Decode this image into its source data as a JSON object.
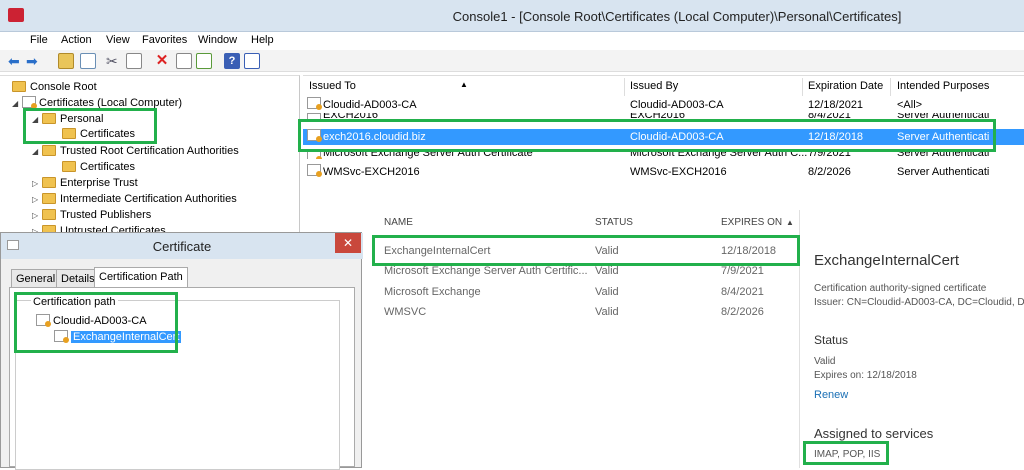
{
  "window": {
    "title": "Console1 - [Console Root\\Certificates (Local Computer)\\Personal\\Certificates]"
  },
  "menu": [
    "File",
    "Action",
    "View",
    "Favorites",
    "Window",
    "Help"
  ],
  "tree": {
    "items": [
      "Console Root",
      "Certificates (Local Computer)",
      "Personal",
      "Certificates",
      "Trusted Root Certification Authorities",
      "Certificates",
      "Enterprise Trust",
      "Intermediate Certification Authorities",
      "Trusted Publishers",
      "Untrusted Certificates"
    ]
  },
  "grid": {
    "columns": [
      "Issued To",
      "Issued By",
      "Expiration Date",
      "Intended Purposes"
    ],
    "rows": [
      [
        "Cloudid-AD003-CA",
        "Cloudid-AD003-CA",
        "12/18/2021",
        "<All>"
      ],
      [
        "EXCH2016",
        "EXCH2016",
        "8/4/2021",
        "Server Authenticati"
      ],
      [
        "exch2016.cloudid.biz",
        "Cloudid-AD003-CA",
        "12/18/2018",
        "Server Authenticati"
      ],
      [
        "Microsoft Exchange Server Auth Certificate",
        "Microsoft Exchange Server Auth C...",
        "7/9/2021",
        "Server Authenticati"
      ],
      [
        "WMSvc-EXCH2016",
        "WMSvc-EXCH2016",
        "8/2/2026",
        "Server Authenticati"
      ]
    ]
  },
  "dialog": {
    "title": "Certificate",
    "close": "✕",
    "tabs": [
      "General",
      "Details",
      "Certification Path"
    ],
    "path_label": "Certification path",
    "path": [
      "Cloudid-AD003-CA",
      "ExchangeInternalCert"
    ]
  },
  "eac": {
    "columns": [
      "NAME",
      "STATUS",
      "EXPIRES ON"
    ],
    "sort_arrow": "▲",
    "rows": [
      [
        "ExchangeInternalCert",
        "Valid",
        "12/18/2018"
      ],
      [
        "Microsoft Exchange Server Auth Certific...",
        "Valid",
        "7/9/2021"
      ],
      [
        "Microsoft Exchange",
        "Valid",
        "8/4/2021"
      ],
      [
        "WMSVC",
        "Valid",
        "8/2/2026"
      ]
    ],
    "detail": {
      "name": "ExchangeInternalCert",
      "type": "Certification authority-signed certificate",
      "issuer": "Issuer: CN=Cloudid-AD003-CA, DC=Cloudid, D",
      "status_heading": "Status",
      "status": "Valid",
      "expires": "Expires on: 12/18/2018",
      "renew": "Renew",
      "services_heading": "Assigned to services",
      "services": "IMAP, POP, IIS"
    }
  },
  "colors": {
    "highlight": "#22b04b",
    "selection": "#3399ff",
    "link": "#1a6fb5"
  }
}
